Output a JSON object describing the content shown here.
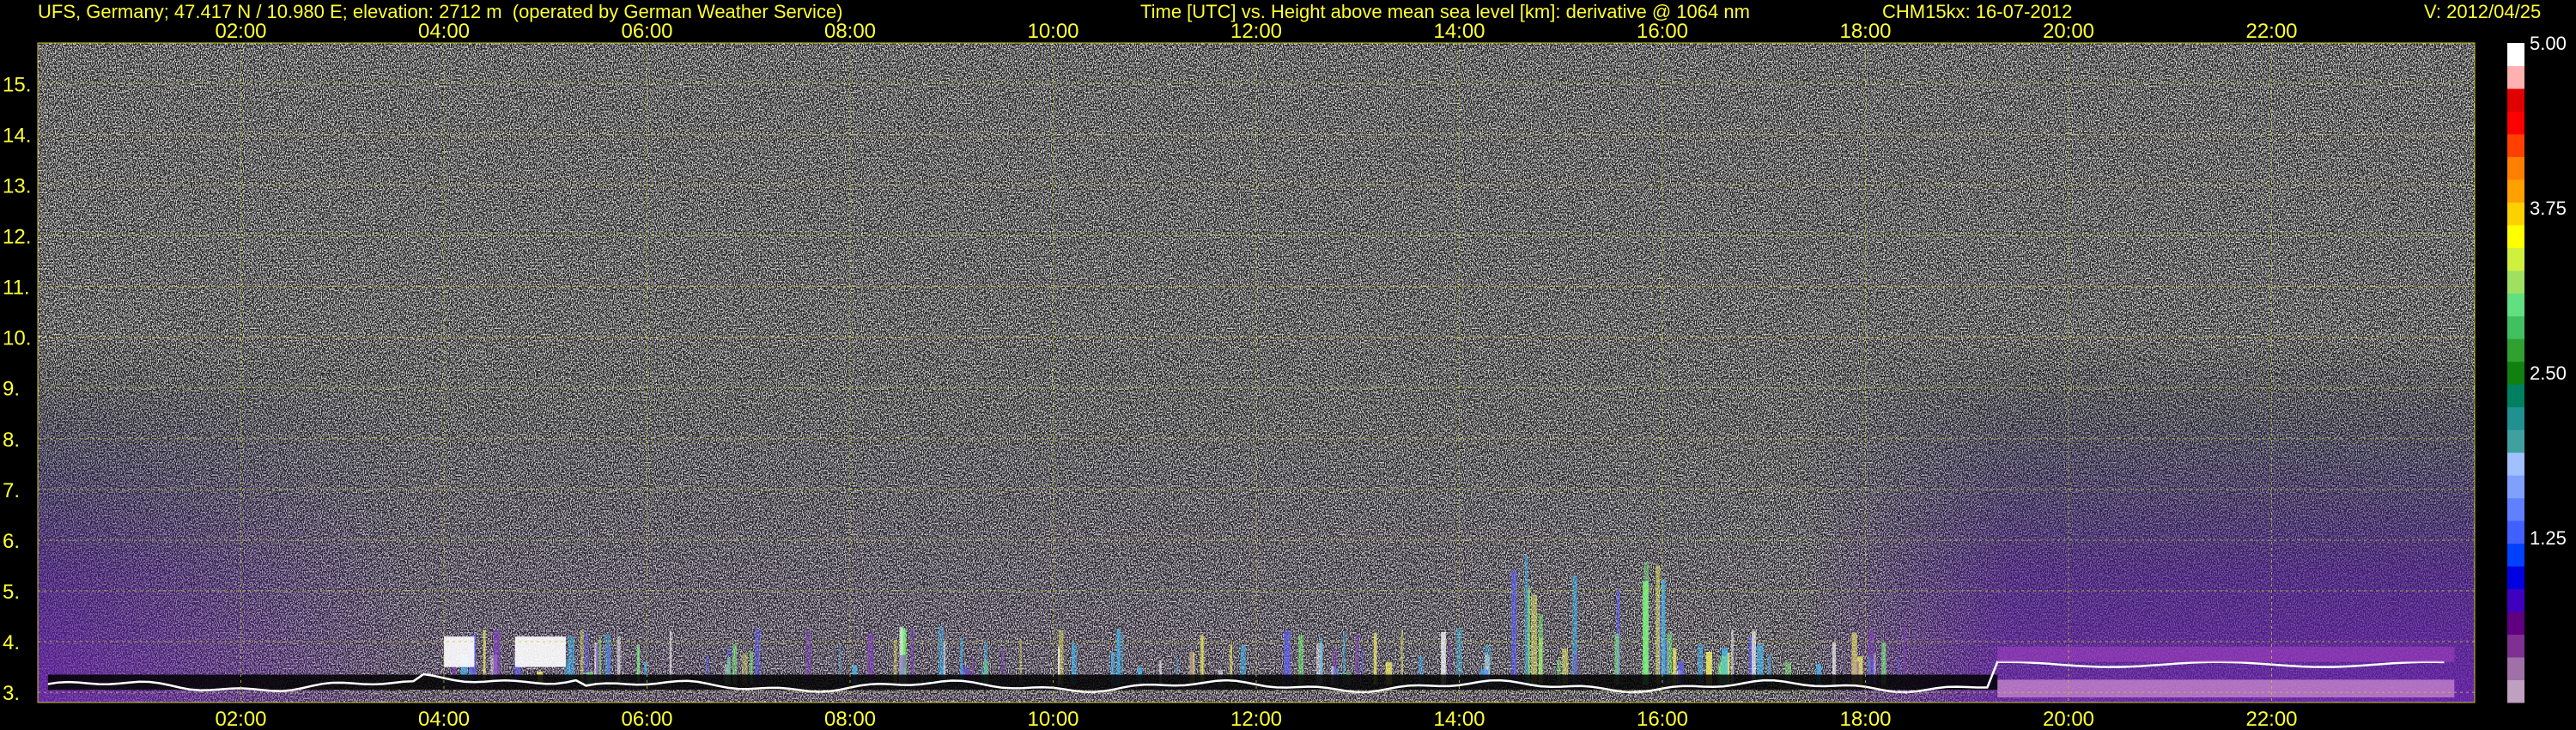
{
  "header": {
    "site": "UFS, Germany; 47.417 N / 10.980 E; elevation: 2712 m  (operated by German Weather Service)",
    "title": "Time [UTC] vs. Height above mean sea level [km]: derivative @ 1064 nm",
    "instrument": "CHM15kx: 16-07-2012",
    "version": "V: 2012/04/25"
  },
  "colors": {
    "text": "#ffff33",
    "background": "#000000",
    "grid": "#c8c832"
  },
  "chart_data": {
    "type": "heatmap",
    "x_ticks": [
      "02:00",
      "04:00",
      "06:00",
      "08:00",
      "10:00",
      "12:00",
      "14:00",
      "16:00",
      "18:00",
      "20:00",
      "22:00"
    ],
    "y_ticks": [
      "3.",
      "4.",
      "5.",
      "6.",
      "7.",
      "8.",
      "9.",
      "10.",
      "11.",
      "12.",
      "13.",
      "14.",
      "15."
    ],
    "xlim_hours": [
      0,
      24
    ],
    "ylim_km": [
      2.8,
      15.8
    ],
    "grid": true,
    "colorbar": {
      "ticks": [
        "1.25",
        "2.50",
        "3.75",
        "5.00"
      ],
      "range": [
        0,
        5
      ],
      "colors": [
        "#c0a0c0",
        "#a070a8",
        "#803090",
        "#600080",
        "#4000c0",
        "#0000e0",
        "#0040ff",
        "#4060ff",
        "#6080ff",
        "#80a0ff",
        "#a0c0ff",
        "#40a0a0",
        "#209090",
        "#008060",
        "#108010",
        "#30a030",
        "#40c060",
        "#60e080",
        "#a0e060",
        "#d0f040",
        "#ffff00",
        "#ffd000",
        "#ffa000",
        "#ff8000",
        "#ff4000",
        "#ff0000",
        "#e00000",
        "#ffb0b0",
        "#ffffff"
      ]
    }
  }
}
